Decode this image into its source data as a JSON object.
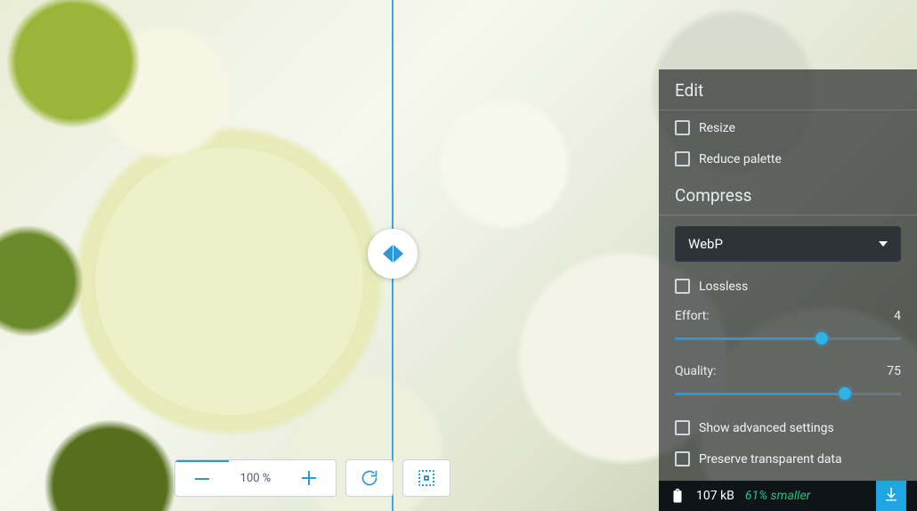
{
  "toolbar": {
    "zoom_label": "100 %"
  },
  "panel": {
    "edit_header": "Edit",
    "resize_label": "Resize",
    "reduce_palette_label": "Reduce palette",
    "compress_header": "Compress",
    "format_selected": "WebP",
    "lossless_label": "Lossless",
    "effort_label": "Effort:",
    "effort_value": "4",
    "effort_pct": 65,
    "quality_label": "Quality:",
    "quality_value": "75",
    "quality_pct": 75,
    "advanced_label": "Show advanced settings",
    "preserve_label": "Preserve transparent data"
  },
  "status": {
    "size": "107 kB",
    "savings": "61% smaller"
  }
}
